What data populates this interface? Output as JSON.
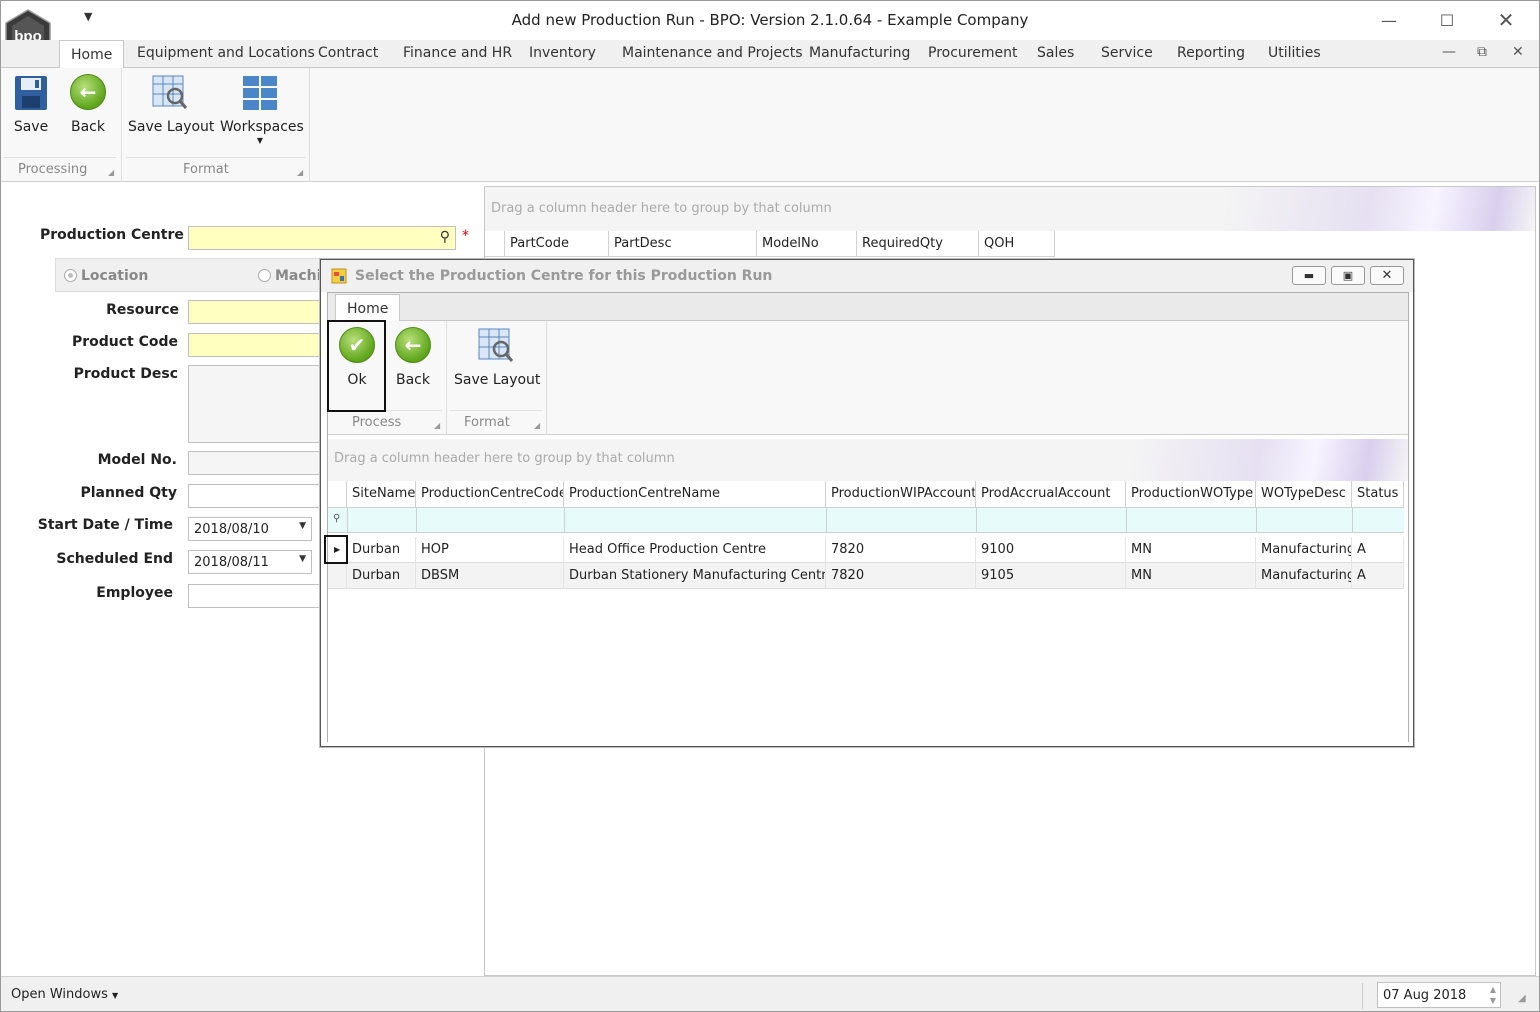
{
  "app": {
    "title": "Add new Production Run - BPO: Version 2.1.0.64 - Example Company"
  },
  "tabs": [
    "Home",
    "Equipment and Locations",
    "Contract",
    "Finance and HR",
    "Inventory",
    "Maintenance and Projects",
    "Manufacturing",
    "Procurement",
    "Sales",
    "Service",
    "Reporting",
    "Utilities"
  ],
  "ribbon": {
    "save": "Save",
    "back": "Back",
    "save_layout": "Save Layout",
    "workspaces": "Workspaces",
    "group_processing": "Processing",
    "group_format": "Format"
  },
  "form": {
    "production_centre_label": "Production Centre",
    "required_mark": "*",
    "radio_location": "Location",
    "radio_machine": "Machi",
    "resource_label": "Resource",
    "product_code_label": "Product Code",
    "product_desc_label": "Product Desc",
    "model_no_label": "Model No.",
    "planned_qty_label": "Planned Qty",
    "start_label": "Start Date / Time",
    "start_value": "2018/08/10",
    "end_label": "Scheduled End",
    "end_value": "2018/08/11",
    "employee_label": "Employee"
  },
  "bg_grid": {
    "group_hint": "Drag a column header here to group by that column",
    "columns": [
      "PartCode",
      "PartDesc",
      "ModelNo",
      "RequiredQty",
      "QOH"
    ]
  },
  "dialog": {
    "title": "Select the Production Centre for this Production Run",
    "tab": "Home",
    "ok": "Ok",
    "back": "Back",
    "save_layout": "Save Layout",
    "group_process": "Process",
    "group_format": "Format",
    "group_hint": "Drag a column header here to group by that column",
    "columns": [
      "SiteName",
      "ProductionCentreCode",
      "ProductionCentreName",
      "ProductionWIPAccount",
      "ProdAccrualAccount",
      "ProductionWOType",
      "WOTypeDesc",
      "Status"
    ],
    "rows": [
      [
        "Durban",
        "HOP",
        "Head Office Production Centre",
        "7820",
        "9100",
        "MN",
        "Manufacturing",
        "A"
      ],
      [
        "Durban",
        "DBSM",
        "Durban Stationery Manufacturing Centre",
        "7820",
        "9105",
        "MN",
        "Manufacturing",
        "A"
      ]
    ]
  },
  "status": {
    "open_windows": "Open Windows",
    "date": "07 Aug 2018"
  },
  "colors": {
    "required": "#ffffc0",
    "filter_row": "#e8fbfb",
    "accent_green": "#5ea51b"
  }
}
